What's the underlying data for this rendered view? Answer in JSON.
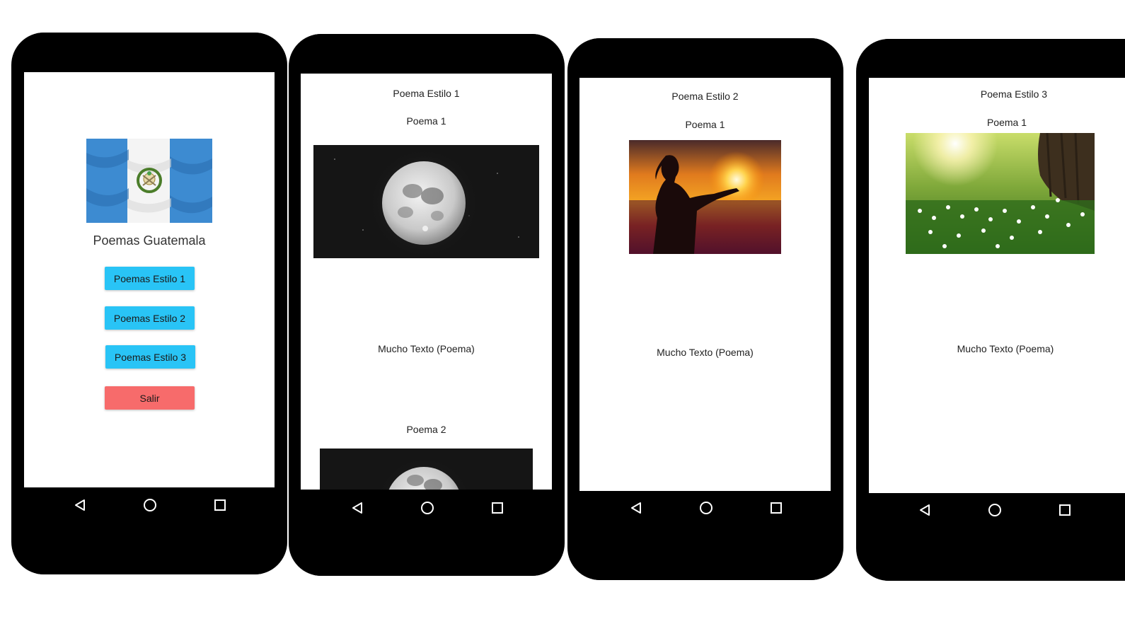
{
  "colors": {
    "device_body": "#000000",
    "screen_bg": "#ffffff",
    "primary_button": "#29c4f6",
    "exit_button": "#f76b6b",
    "text": "#222222"
  },
  "screens": {
    "home": {
      "flag_image": "guatemala-flag",
      "title": "Poemas Guatemala",
      "buttons": {
        "estilo1": "Poemas Estilo 1",
        "estilo2": "Poemas Estilo 2",
        "estilo3": "Poemas Estilo 3",
        "salir": "Salir"
      }
    },
    "estilo1": {
      "header": "Poema Estilo 1",
      "poem1_title": "Poema 1",
      "poem1_image": "full-moon",
      "poem1_text": "Mucho Texto (Poema)",
      "poem2_title": "Poema 2",
      "poem2_image": "full-moon"
    },
    "estilo2": {
      "header": "Poema Estilo 2",
      "poem1_title": "Poema 1",
      "poem1_image": "woman-silhouette-sunset",
      "poem1_text": "Mucho Texto (Poema)"
    },
    "estilo3": {
      "header": "Poema Estilo 3",
      "poem1_title": "Poema 1",
      "poem1_image": "sunlit-meadow-tree",
      "poem1_text": "Mucho Texto (Poema)"
    }
  },
  "navbar": {
    "back_icon": "back-triangle-icon",
    "home_icon": "home-circle-icon",
    "recents_icon": "recents-square-icon"
  }
}
